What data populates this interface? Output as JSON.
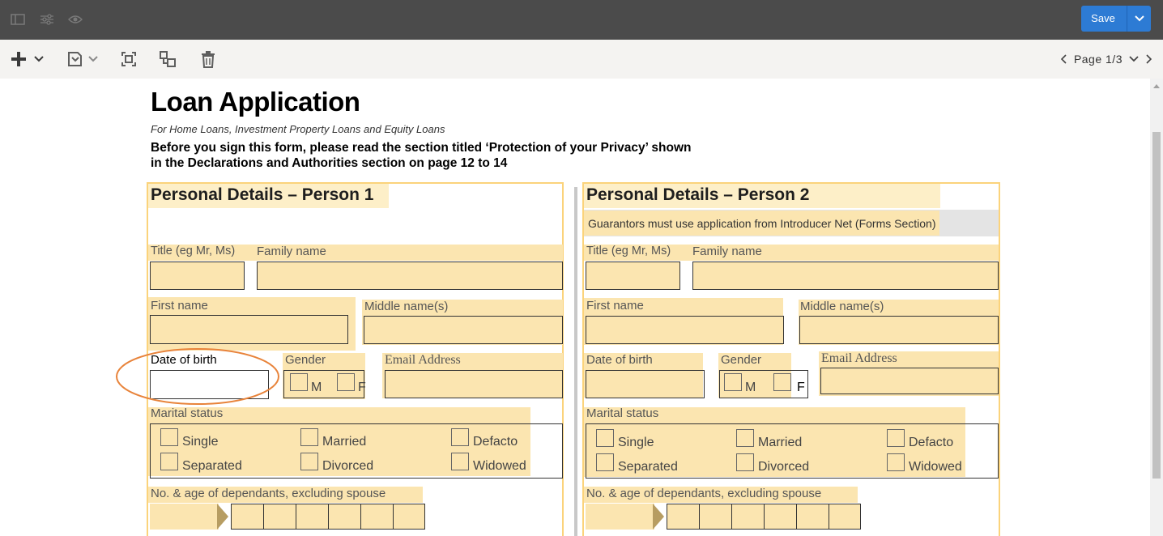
{
  "toolbar": {
    "save_label": "Save",
    "page_label": "Page 1/3"
  },
  "doc": {
    "title": "Loan Application",
    "subtitle": "For Home Loans, Investment Property Loans and Equity Loans",
    "notice_line1": "Before you sign this form, please read the section titled ‘Protection of your Privacy’ shown",
    "notice_line2": "in the Declarations and Authorities section on page 12 to 14"
  },
  "person1": {
    "title": "Personal Details – Person 1",
    "title_field": "Title (eg Mr, Ms)",
    "family_name": "Family name",
    "first_name": "First name",
    "middle_name": "Middle name(s)",
    "dob": "Date of birth",
    "gender": "Gender",
    "gender_m": "M",
    "gender_f": "F",
    "email": "Email Address",
    "marital": "Marital status",
    "single": "Single",
    "married": "Married",
    "defacto": "Defacto",
    "separated": "Separated",
    "divorced": "Divorced",
    "widowed": "Widowed",
    "dependants": "No. & age of dependants, excluding spouse"
  },
  "person2": {
    "title": "Personal Details – Person 2",
    "guarantor_note": "Guarantors must use application from Introducer Net (Forms Section)",
    "title_field": "Title (eg Mr, Ms)",
    "family_name": "Family name",
    "first_name": "First name",
    "middle_name": "Middle name(s)",
    "dob": "Date of birth",
    "gender": "Gender",
    "gender_m": "M",
    "gender_f": "F",
    "email": "Email Address",
    "marital": "Marital status",
    "single": "Single",
    "married": "Married",
    "defacto": "Defacto",
    "separated": "Separated",
    "divorced": "Divorced",
    "widowed": "Widowed",
    "dependants": "No. & age of dependants, excluding spouse"
  },
  "colors": {
    "topbar": "#4b4b4b",
    "save_button": "#2d7bd4",
    "field_highlight": "#fbe5b0",
    "panel_border": "#fbd37b",
    "annotation_circle": "#e8833a"
  }
}
